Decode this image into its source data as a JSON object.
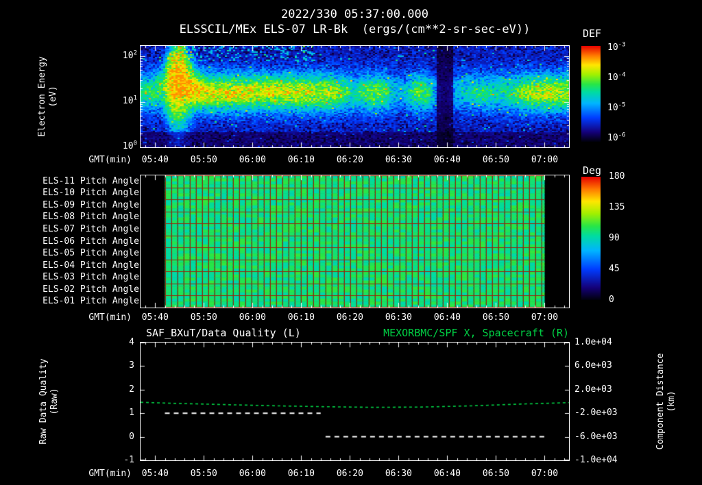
{
  "header": {
    "title": "2022/330 05:37:00.000",
    "subtitle": "ELSSCIL/MEx ELS-07 LR-Bk  (ergs/(cm**2-sr-sec-eV))"
  },
  "time_axis": {
    "label": "GMT(min)",
    "start": "05:37",
    "end": "07:05",
    "ticks": [
      "05:40",
      "05:50",
      "06:00",
      "06:10",
      "06:20",
      "06:30",
      "06:40",
      "06:50",
      "07:00"
    ]
  },
  "spectrogram": {
    "ylabel_line1": "Electron Energy",
    "ylabel_line2": "(eV)",
    "yticks": [
      {
        "base": "10",
        "exp": "2"
      },
      {
        "base": "10",
        "exp": "1"
      },
      {
        "base": "10",
        "exp": "0"
      }
    ],
    "colorbar": {
      "label": "DEF",
      "ticks": [
        {
          "base": "10",
          "exp": "-3"
        },
        {
          "base": "10",
          "exp": "-4"
        },
        {
          "base": "10",
          "exp": "-5"
        },
        {
          "base": "10",
          "exp": "-6"
        }
      ]
    }
  },
  "pitch_panel": {
    "rows": [
      "ELS-11 Pitch Angle",
      "ELS-10 Pitch Angle",
      "ELS-09 Pitch Angle",
      "ELS-08 Pitch Angle",
      "ELS-07 Pitch Angle",
      "ELS-06 Pitch Angle",
      "ELS-05 Pitch Angle",
      "ELS-04 Pitch Angle",
      "ELS-03 Pitch Angle",
      "ELS-02 Pitch Angle",
      "ELS-01 Pitch Angle"
    ],
    "colorbar": {
      "label": "Deg",
      "ticks": [
        "180",
        "135",
        "90",
        "45",
        "0"
      ]
    }
  },
  "line_panel": {
    "title_left": "SAF_BXuT/Data Quality (L)",
    "title_right": "MEXORBMC/SPF X, Spacecraft (R)",
    "left_axis": {
      "line1": "Raw Data Quality",
      "line2": "(Raw)",
      "ticks": [
        "4",
        "3",
        "2",
        "1",
        "0",
        "-1"
      ]
    },
    "right_axis": {
      "line1": "Component Distance",
      "line2": "(km)",
      "ticks": [
        "1.0e+04",
        "6.0e+03",
        "2.0e+03",
        "-2.0e+03",
        "-6.0e+03",
        "-1.0e+04"
      ]
    }
  },
  "colors": {
    "background": "#000000",
    "text": "#ffffff",
    "frame": "#ffffff",
    "accent_green": "#00d044",
    "grid_red": "#96280a"
  },
  "chart_data": [
    {
      "type": "heatmap",
      "name": "electron-energy-spectrogram",
      "title": "2022/330 05:37:00.000",
      "subtitle": "ELSSCIL/MEx ELS-07 LR-Bk (ergs/(cm**2-sr-sec-eV))",
      "xlabel": "GMT(min)",
      "x_range": [
        "05:37",
        "07:05"
      ],
      "x_ticks": [
        "05:40",
        "05:50",
        "06:00",
        "06:10",
        "06:20",
        "06:30",
        "06:40",
        "06:50",
        "07:00"
      ],
      "ylabel": "Electron Energy (eV)",
      "y_scale": "log",
      "y_range_ev": [
        1,
        170
      ],
      "y_ticks_ev": [
        1,
        10,
        100
      ],
      "colorbar": {
        "label": "DEF",
        "units": "ergs/(cm**2-sr-sec-eV)",
        "scale": "log",
        "tick_values": [
          0.001,
          0.0001,
          1e-05,
          1e-06
        ]
      },
      "band": {
        "center_log10_ev": 1.22,
        "sigma_log10": 0.3,
        "plume_time": 0.085
      },
      "dropout": {
        "t0": 0.69,
        "t1": 0.725
      },
      "intensity_profile": {
        "t": [
          0,
          0.05,
          0.068,
          0.09,
          0.12,
          0.16,
          0.25,
          0.35,
          0.44,
          0.47,
          0.5,
          0.53,
          0.56,
          0.585,
          0.61,
          0.64,
          0.665,
          0.69,
          0.71,
          0.73,
          0.76,
          0.8,
          0.84,
          0.87,
          0.9,
          0.95,
          1
        ],
        "amplitude": [
          0.5,
          0.6,
          0.95,
          1,
          0.9,
          0.82,
          0.8,
          0.78,
          0.74,
          0.6,
          0.45,
          0.62,
          0.66,
          0.4,
          0.3,
          0.62,
          0.6,
          0.25,
          0.12,
          0.3,
          0.45,
          0.5,
          0.45,
          0.55,
          0.72,
          0.75,
          0.7
        ]
      },
      "features": [
        "bright yellow plume 05:43-05:48 extending to ~100 eV",
        "continuous 10-40 eV green/yellow band 05:48-06:18",
        "isolated green blobs near 06:25 and 06:35",
        "near-black dropout 06:38-06:41",
        "band brightens again after 06:55"
      ]
    },
    {
      "type": "heatmap",
      "name": "pitch-angle-panels",
      "rows": [
        "ELS-11",
        "ELS-10",
        "ELS-09",
        "ELS-08",
        "ELS-07",
        "ELS-06",
        "ELS-05",
        "ELS-04",
        "ELS-03",
        "ELS-02",
        "ELS-01"
      ],
      "quantity": "Pitch Angle",
      "colorbar": {
        "label": "Deg",
        "range": [
          0,
          180
        ],
        "tick_values": [
          180,
          135,
          90,
          45,
          0
        ]
      },
      "data_extent": [
        "05:42",
        "07:00"
      ],
      "approx_value_deg": 100
    },
    {
      "type": "line",
      "name": "data-quality-and-spacecraft-x",
      "xlabel": "GMT(min)",
      "x_range": [
        "05:37",
        "07:05"
      ],
      "left_axis": {
        "label": "Raw Data Quality (Raw)",
        "range": [
          -1,
          4
        ],
        "tick_values": [
          4,
          3,
          2,
          1,
          0,
          -1
        ]
      },
      "right_axis": {
        "label": "Component Distance (km)",
        "range": [
          -10000,
          10000
        ],
        "tick_values": [
          10000,
          6000,
          2000,
          -2000,
          -6000,
          -10000
        ]
      },
      "series": [
        {
          "name": "SAF_BXuT/Data Quality (L)",
          "axis": "left",
          "color": "#ffffff",
          "style": "dashed",
          "segments": [
            {
              "t_start": "05:42",
              "t_end": "06:14",
              "value": 1
            },
            {
              "t_start": "06:15",
              "t_end": "07:00",
              "value": 0
            }
          ]
        },
        {
          "name": "MEXORBMC/SPF X, Spacecraft (R)",
          "axis": "right",
          "color": "#00d044",
          "style": "dashed",
          "t": [
            "05:37",
            "05:45",
            "05:55",
            "06:05",
            "06:15",
            "06:25",
            "06:35",
            "06:45",
            "06:55",
            "07:05"
          ],
          "value_km": [
            -150,
            -350,
            -550,
            -750,
            -900,
            -1000,
            -950,
            -750,
            -450,
            -200
          ]
        }
      ]
    }
  ]
}
